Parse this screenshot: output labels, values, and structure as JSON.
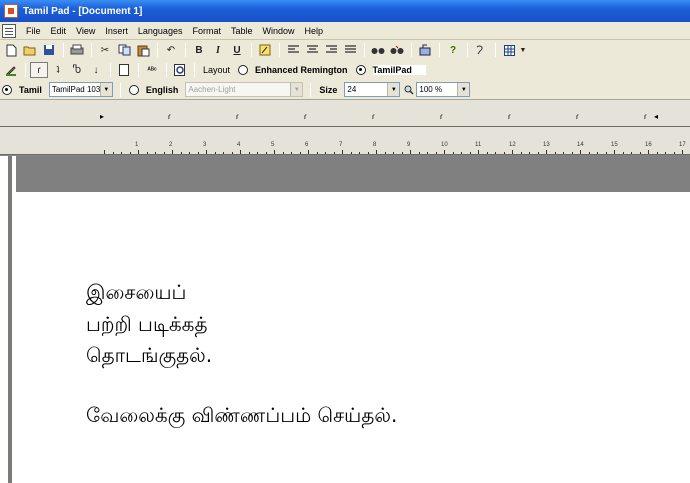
{
  "window": {
    "title": "Tamil Pad - [Document 1]"
  },
  "menu": [
    "File",
    "Edit",
    "View",
    "Insert",
    "Languages",
    "Format",
    "Table",
    "Window",
    "Help"
  ],
  "toolbar1": {
    "bold": "B",
    "italic": "I",
    "underline": "U"
  },
  "toolbar2": {
    "layout_label": "Layout",
    "layout_options": [
      "Enhanced Remington",
      "TamilPad"
    ],
    "layout_selected": "TamilPad"
  },
  "toolbar3": {
    "tamil_label": "Tamil",
    "tamil_font": "TamilPad 103",
    "english_label": "English",
    "english_font": "Aachen-Light",
    "size_label": "Size",
    "size_value": "24",
    "zoom_value": "100 %"
  },
  "ruler": {
    "numbers": [
      "1",
      "2",
      "3",
      "4",
      "5",
      "6",
      "7",
      "8",
      "9",
      "10",
      "11",
      "12",
      "13",
      "14",
      "15",
      "16",
      "17"
    ]
  },
  "document": {
    "lines": [
      "இசையைப்",
      "பற்றி   படிக்கத்",
      "தொடங்குதல்.",
      "வேலைக்கு விண்ணப்பம் செய்தல்."
    ]
  },
  "colors": {
    "titlebar": "#1c5fd8",
    "workspace": "#808080",
    "chrome": "#ece9d8"
  }
}
